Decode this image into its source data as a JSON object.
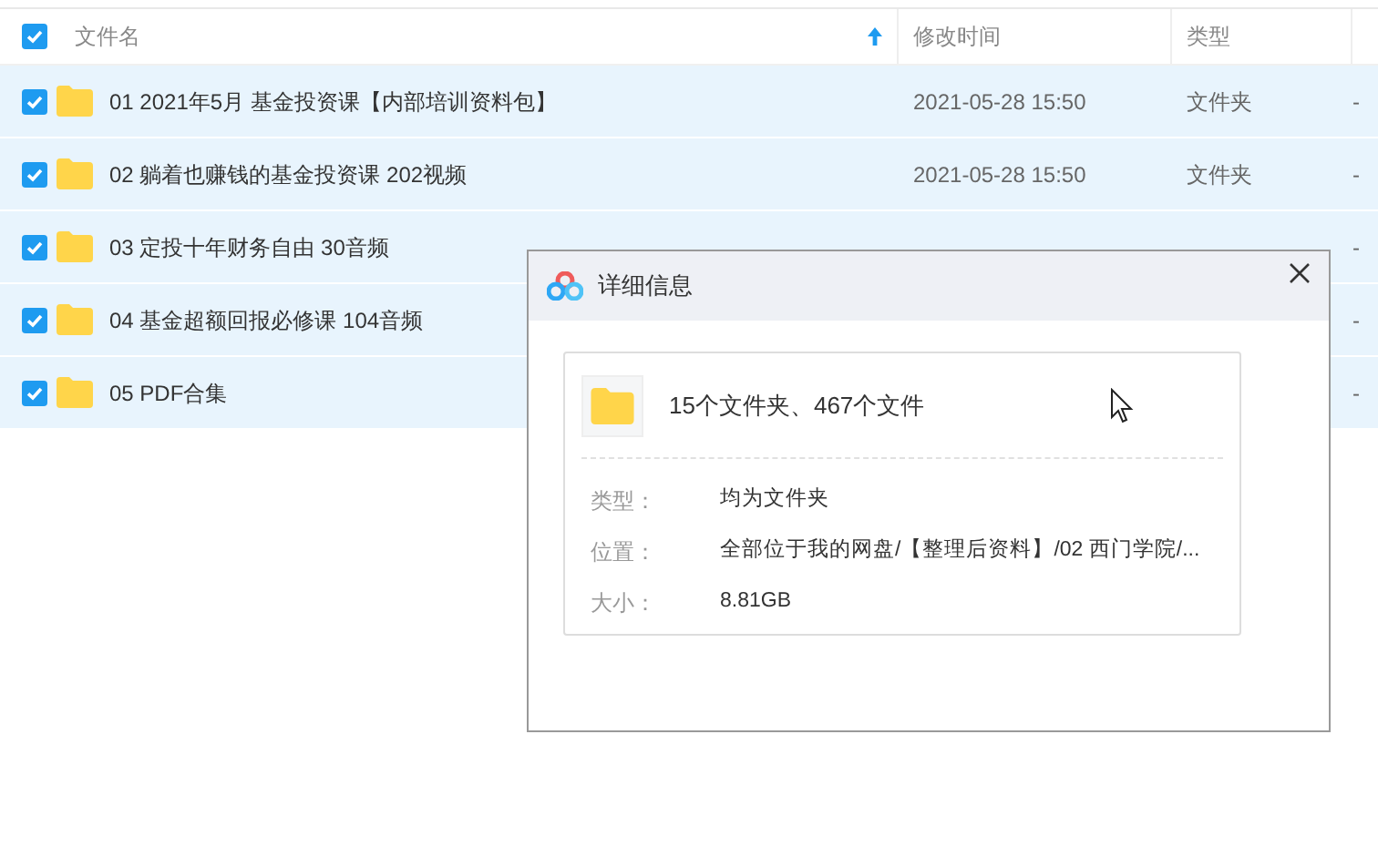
{
  "header": {
    "checked": true,
    "columns": [
      "文件名",
      "修改时间",
      "类型"
    ],
    "sort_ascending": true
  },
  "rows": [
    {
      "checked": true,
      "selected": true,
      "name": "01 2021年5月 基金投资课【内部培训资料包】",
      "modified": "2021-05-28 15:50",
      "type": "文件夹",
      "size": "-"
    },
    {
      "checked": true,
      "selected": true,
      "name": "02 躺着也赚钱的基金投资课 202视频",
      "modified": "2021-05-28 15:50",
      "type": "文件夹",
      "size": "-"
    },
    {
      "checked": true,
      "selected": true,
      "name": "03 定投十年财务自由 30音频",
      "size": "-"
    },
    {
      "checked": true,
      "selected": true,
      "name": "04 基金超额回报必修课 104音频",
      "size": "-"
    },
    {
      "checked": true,
      "selected": true,
      "name": "05 PDF合集",
      "size": "-"
    }
  ],
  "dialog": {
    "title": "详细信息",
    "summary": "15个文件夹、467个文件",
    "details": [
      {
        "label": "类型：",
        "value": "均为文件夹"
      },
      {
        "label": "位置：",
        "value": "全部位于我的网盘/【整理后资料】/02 西门学院/..."
      },
      {
        "label": "大小：",
        "value": "8.81GB"
      }
    ]
  }
}
